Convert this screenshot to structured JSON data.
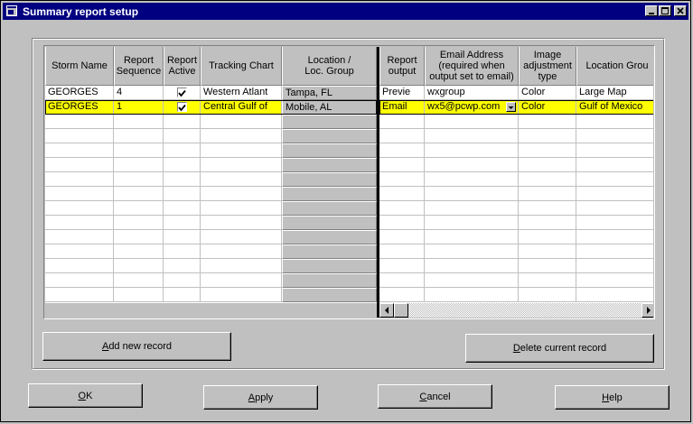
{
  "window": {
    "title": "Summary report setup"
  },
  "grid": {
    "frozen_columns": [
      {
        "key": "storm",
        "header": "Storm Name"
      },
      {
        "key": "seq",
        "header": "Report\nSequence"
      },
      {
        "key": "active",
        "header": "Report\nActive"
      },
      {
        "key": "chart",
        "header": "Tracking Chart"
      },
      {
        "key": "location",
        "header": "Location /\nLoc. Group"
      }
    ],
    "scroll_columns": [
      {
        "key": "output",
        "header": "Report\noutput"
      },
      {
        "key": "email",
        "header": "Email Address\n(required when\noutput set to email)"
      },
      {
        "key": "image",
        "header": "Image\nadjustment\ntype"
      },
      {
        "key": "locgroup",
        "header": "Location Grou"
      }
    ],
    "rows": [
      {
        "storm": "GEORGES",
        "seq": "4",
        "active": true,
        "chart": "Western Atlant",
        "location": "Tampa, FL",
        "output": "Previe",
        "email": "wxgroup",
        "image": "Color",
        "locgroup": "Large Map",
        "selected": false
      },
      {
        "storm": "GEORGES",
        "seq": "1",
        "active": true,
        "chart": "Central Gulf of",
        "location": "Mobile, AL",
        "output": "Email",
        "email": "wx5@pcwp.com",
        "image": "Color",
        "locgroup": "Gulf of Mexico",
        "selected": true
      }
    ],
    "empty_row_count": 13
  },
  "buttons": {
    "add_accel": "A",
    "add_rest": "dd new record",
    "delete_accel": "D",
    "delete_rest": "elete current record",
    "ok_accel": "O",
    "ok_rest": "K",
    "apply_accel": "A",
    "apply_rest": "pply",
    "cancel_accel": "C",
    "cancel_rest": "ancel",
    "help_accel": "H",
    "help_rest": "elp"
  },
  "colors": {
    "titlebar": "#000080",
    "selection": "#ffff00",
    "face": "#c0c0c0"
  }
}
